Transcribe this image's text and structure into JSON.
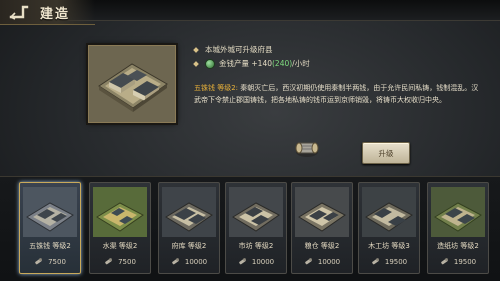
{
  "header": {
    "title": "建造"
  },
  "selected": {
    "bullet1": "本城外城可升级府县",
    "bullet2_prefix": "金钱产量 +",
    "bullet2_value": "140",
    "bullet2_bonus": "(240)",
    "bullet2_suffix": "/小时",
    "desc_title": "五铢钱 等级2:",
    "desc_body": "秦朝灭亡后，西汉初期仍使用秦制半两钱，由于允许民间私铸，钱制混乱。汉武帝下令禁止郡国铸钱，把各地私铸的钱币运到京师销毁，将铸币大权收归中央。",
    "upgrade_label": "升级"
  },
  "cards": [
    {
      "label": "五铢钱 等级2",
      "cost": "7500",
      "selected": true
    },
    {
      "label": "水渠 等级2",
      "cost": "7500",
      "selected": false
    },
    {
      "label": "府库 等级2",
      "cost": "10000",
      "selected": false
    },
    {
      "label": "市坊 等级2",
      "cost": "10000",
      "selected": false
    },
    {
      "label": "粮仓 等级2",
      "cost": "10000",
      "selected": false
    },
    {
      "label": "木工坊 等级3",
      "cost": "19500",
      "selected": false
    },
    {
      "label": "造纸坊 等级2",
      "cost": "19500",
      "selected": false
    }
  ],
  "colors": {
    "accent_gold": "#c9a95a",
    "highlight": "#e8b13a",
    "bonus_green": "#7fdc7f"
  }
}
